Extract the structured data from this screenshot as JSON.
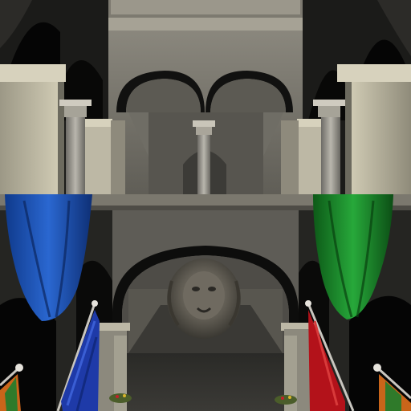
{
  "scene": {
    "subject": "sponza-atrium-render",
    "colors": {
      "stone_light": "#cfcab6",
      "stone_mid": "#8d8a7e",
      "stone_dark": "#4a4943",
      "shadow": "#0c0c0b",
      "curtain_blue": "#1a4fb0",
      "curtain_green": "#1b8a2a",
      "banner_red": "#b3121a",
      "banner_blue": "#1e3aa8",
      "banner_multi": "#c9651a"
    }
  }
}
